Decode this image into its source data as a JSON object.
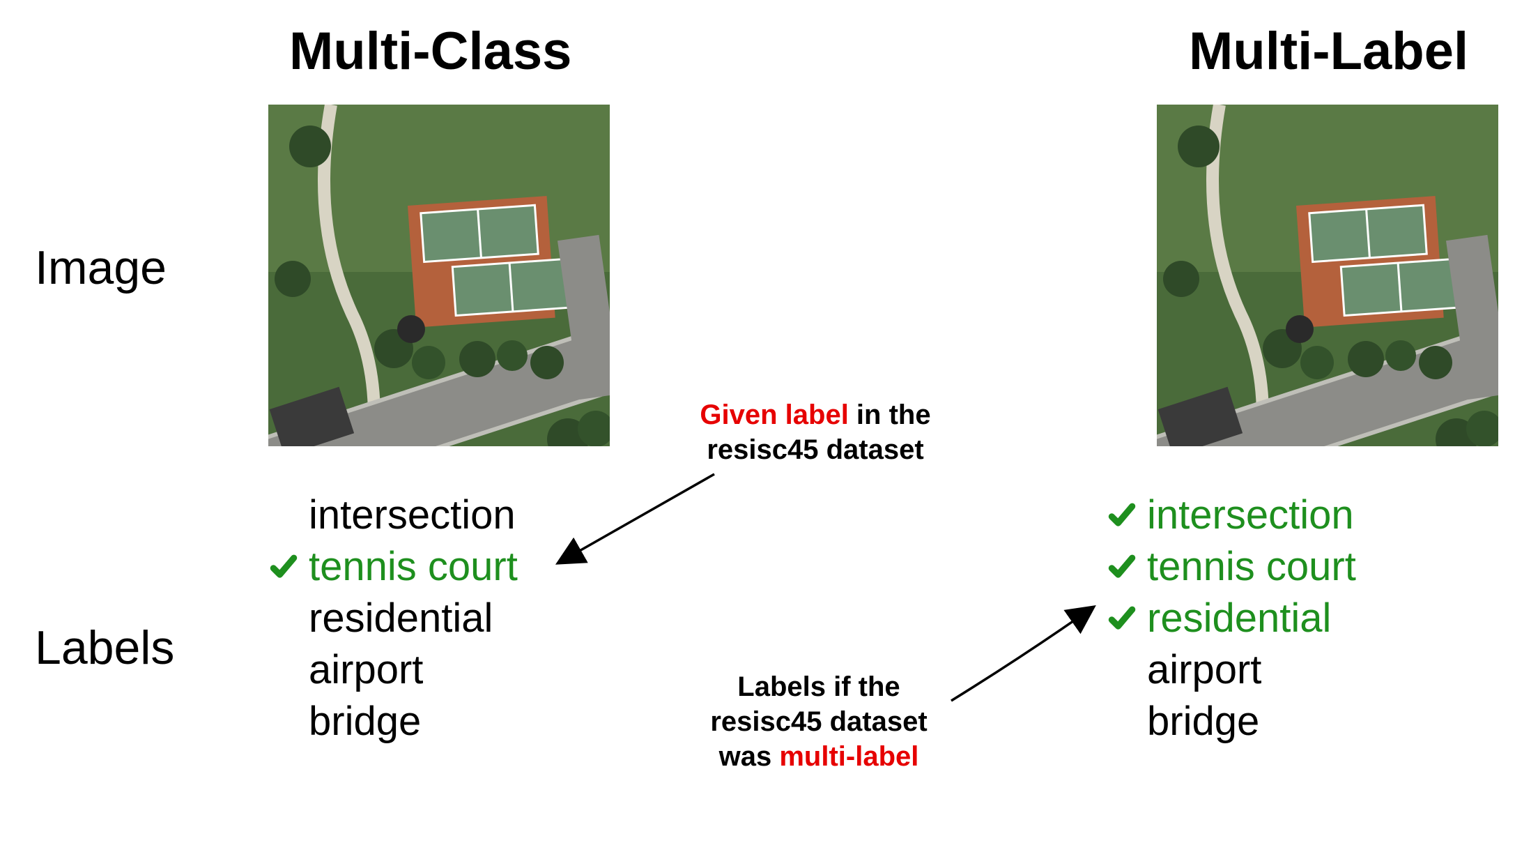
{
  "headings": {
    "left": "Multi-Class",
    "right": "Multi-Label"
  },
  "sideLabels": {
    "image": "Image",
    "labels": "Labels"
  },
  "labels_left": [
    {
      "text": "intersection",
      "checked": false
    },
    {
      "text": "tennis court",
      "checked": true
    },
    {
      "text": "residential",
      "checked": false
    },
    {
      "text": "airport",
      "checked": false
    },
    {
      "text": "bridge",
      "checked": false
    }
  ],
  "labels_right": [
    {
      "text": "intersection",
      "checked": true
    },
    {
      "text": "tennis court",
      "checked": true
    },
    {
      "text": "residential",
      "checked": true
    },
    {
      "text": "airport",
      "checked": false
    },
    {
      "text": "bridge",
      "checked": false
    }
  ],
  "annot1": {
    "red": "Given label",
    "rest": " in the",
    "line2": "resisc45 dataset"
  },
  "annot2": {
    "line1": "Labels if the",
    "line2": "resisc45 dataset",
    "line3a": "was ",
    "line3red": "multi-label"
  },
  "colors": {
    "green": "#1e8f1e",
    "red": "#e60000",
    "black": "#000000"
  }
}
